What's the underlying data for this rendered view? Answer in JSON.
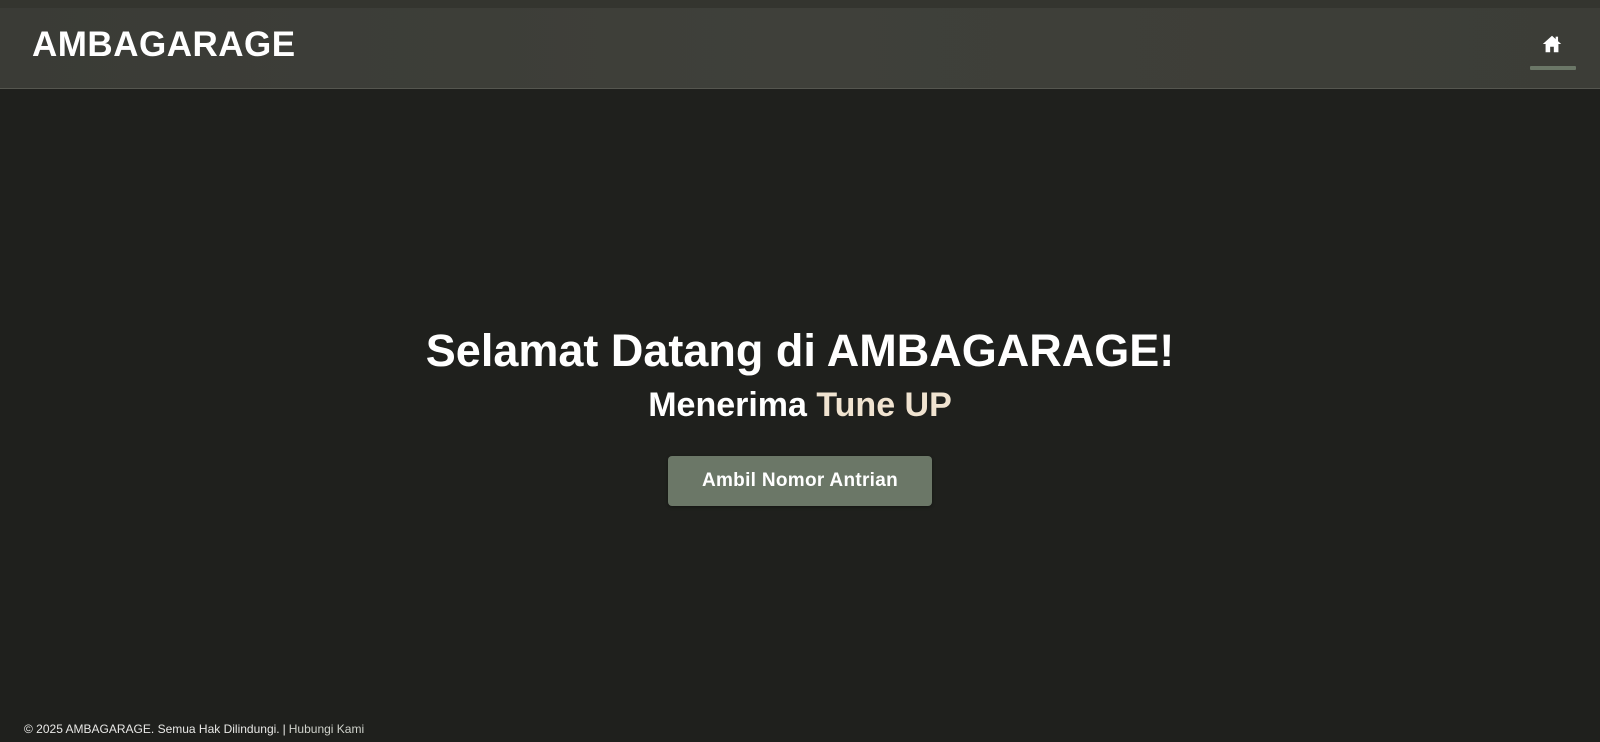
{
  "header": {
    "brand": "AMBAGARAGE",
    "home_icon": "home-icon"
  },
  "hero": {
    "title": "Selamat Datang di AMBAGARAGE!",
    "subtitle_prefix": "Menerima",
    "subtitle_accent": "Tune UP",
    "button_label": "Ambil Nomor Antrian"
  },
  "footer": {
    "copyright": "© 2025 AMBAGARAGE. Semua Hak Dilindungi.",
    "separator": "|",
    "contact_link": "Hubungi Kami"
  },
  "colors": {
    "background": "#1f201d",
    "navbar": "#3f403a",
    "accent": "#6b7767",
    "highlight_text": "#f0e3d0"
  }
}
